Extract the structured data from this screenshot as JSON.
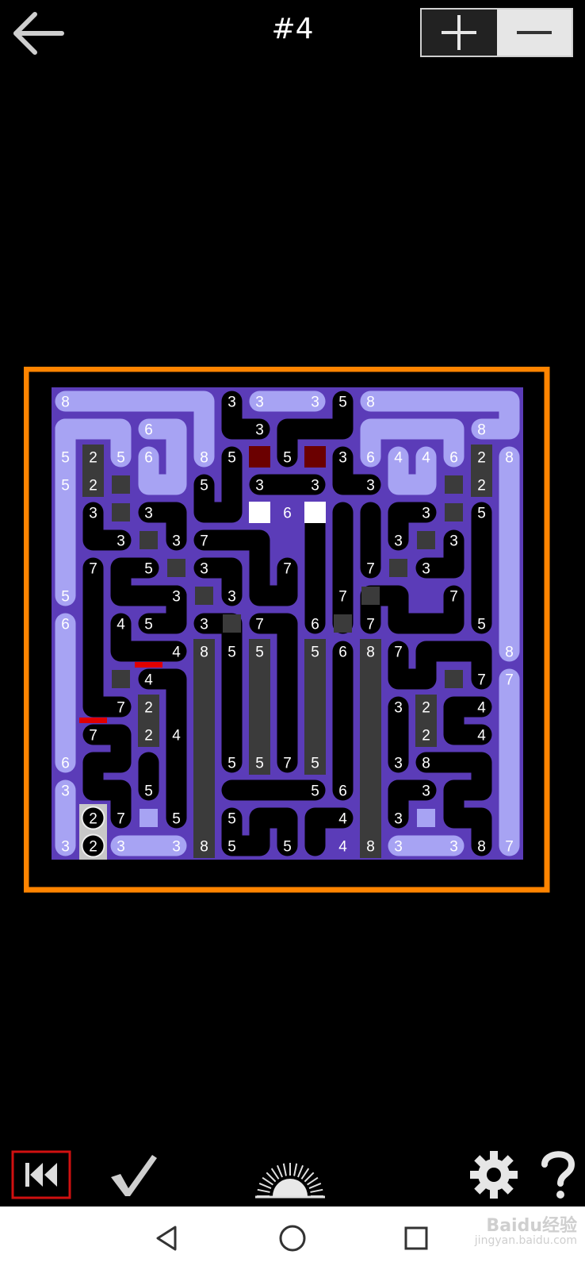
{
  "header": {
    "level_title": "#4",
    "back_icon": "back-arrow-icon",
    "zoom_in_icon": "plus-icon",
    "zoom_out_icon": "minus-icon"
  },
  "colors": {
    "frame": "#ff8400",
    "board_bg": "#5b3cb8",
    "pipe_light": "#a7a3f3",
    "pipe_dark": "#000000",
    "block": "#3b3b3b",
    "source_dark_red": "#6b0000",
    "target_white": "#ffffff",
    "mark_red": "#e00000"
  },
  "board": {
    "rows": 16,
    "cols": 17,
    "numbers": [
      {
        "r": 0,
        "c": 0,
        "v": "8"
      },
      {
        "r": 0,
        "c": 6,
        "v": "3"
      },
      {
        "r": 0,
        "c": 7,
        "v": "3"
      },
      {
        "r": 0,
        "c": 9,
        "v": "3"
      },
      {
        "r": 0,
        "c": 10,
        "v": "5"
      },
      {
        "r": 0,
        "c": 11,
        "v": "8"
      },
      {
        "r": 1,
        "c": 3,
        "v": "6"
      },
      {
        "r": 1,
        "c": 7,
        "v": "3"
      },
      {
        "r": 1,
        "c": 15,
        "v": "8"
      },
      {
        "r": 2,
        "c": 0,
        "v": "5"
      },
      {
        "r": 2,
        "c": 1,
        "v": "2"
      },
      {
        "r": 2,
        "c": 2,
        "v": "5"
      },
      {
        "r": 2,
        "c": 3,
        "v": "6"
      },
      {
        "r": 2,
        "c": 5,
        "v": "8"
      },
      {
        "r": 2,
        "c": 6,
        "v": "5"
      },
      {
        "r": 2,
        "c": 8,
        "v": "5"
      },
      {
        "r": 2,
        "c": 10,
        "v": "3"
      },
      {
        "r": 2,
        "c": 11,
        "v": "6"
      },
      {
        "r": 2,
        "c": 12,
        "v": "4"
      },
      {
        "r": 2,
        "c": 13,
        "v": "4"
      },
      {
        "r": 2,
        "c": 14,
        "v": "6"
      },
      {
        "r": 2,
        "c": 15,
        "v": "2"
      },
      {
        "r": 2,
        "c": 16,
        "v": "8"
      },
      {
        "r": 3,
        "c": 0,
        "v": "5"
      },
      {
        "r": 3,
        "c": 1,
        "v": "2"
      },
      {
        "r": 3,
        "c": 5,
        "v": "5"
      },
      {
        "r": 3,
        "c": 7,
        "v": "3"
      },
      {
        "r": 3,
        "c": 9,
        "v": "3"
      },
      {
        "r": 3,
        "c": 11,
        "v": "3"
      },
      {
        "r": 3,
        "c": 15,
        "v": "2"
      },
      {
        "r": 4,
        "c": 1,
        "v": "3"
      },
      {
        "r": 4,
        "c": 3,
        "v": "3"
      },
      {
        "r": 4,
        "c": 8,
        "v": "6"
      },
      {
        "r": 4,
        "c": 13,
        "v": "3"
      },
      {
        "r": 4,
        "c": 15,
        "v": "5"
      },
      {
        "r": 5,
        "c": 2,
        "v": "3"
      },
      {
        "r": 5,
        "c": 4,
        "v": "3"
      },
      {
        "r": 5,
        "c": 5,
        "v": "7"
      },
      {
        "r": 5,
        "c": 12,
        "v": "3"
      },
      {
        "r": 5,
        "c": 14,
        "v": "3"
      },
      {
        "r": 6,
        "c": 1,
        "v": "7"
      },
      {
        "r": 6,
        "c": 3,
        "v": "5"
      },
      {
        "r": 6,
        "c": 5,
        "v": "3"
      },
      {
        "r": 6,
        "c": 8,
        "v": "7"
      },
      {
        "r": 6,
        "c": 11,
        "v": "7"
      },
      {
        "r": 6,
        "c": 13,
        "v": "3"
      },
      {
        "r": 7,
        "c": 0,
        "v": "5"
      },
      {
        "r": 7,
        "c": 4,
        "v": "3"
      },
      {
        "r": 7,
        "c": 6,
        "v": "3"
      },
      {
        "r": 7,
        "c": 10,
        "v": "7"
      },
      {
        "r": 7,
        "c": 14,
        "v": "7"
      },
      {
        "r": 8,
        "c": 0,
        "v": "6"
      },
      {
        "r": 8,
        "c": 2,
        "v": "4"
      },
      {
        "r": 8,
        "c": 3,
        "v": "5"
      },
      {
        "r": 8,
        "c": 5,
        "v": "3"
      },
      {
        "r": 8,
        "c": 7,
        "v": "7"
      },
      {
        "r": 8,
        "c": 9,
        "v": "6"
      },
      {
        "r": 8,
        "c": 11,
        "v": "7"
      },
      {
        "r": 8,
        "c": 15,
        "v": "5"
      },
      {
        "r": 9,
        "c": 4,
        "v": "4"
      },
      {
        "r": 9,
        "c": 5,
        "v": "8"
      },
      {
        "r": 9,
        "c": 6,
        "v": "5"
      },
      {
        "r": 9,
        "c": 7,
        "v": "5"
      },
      {
        "r": 9,
        "c": 9,
        "v": "5"
      },
      {
        "r": 9,
        "c": 10,
        "v": "6"
      },
      {
        "r": 9,
        "c": 11,
        "v": "8"
      },
      {
        "r": 9,
        "c": 12,
        "v": "7"
      },
      {
        "r": 9,
        "c": 16,
        "v": "8"
      },
      {
        "r": 10,
        "c": 3,
        "v": "4"
      },
      {
        "r": 10,
        "c": 15,
        "v": "7"
      },
      {
        "r": 10,
        "c": 16,
        "v": "7"
      },
      {
        "r": 11,
        "c": 2,
        "v": "7"
      },
      {
        "r": 11,
        "c": 3,
        "v": "2"
      },
      {
        "r": 11,
        "c": 12,
        "v": "3"
      },
      {
        "r": 11,
        "c": 13,
        "v": "2"
      },
      {
        "r": 11,
        "c": 15,
        "v": "4"
      },
      {
        "r": 12,
        "c": 1,
        "v": "7"
      },
      {
        "r": 12,
        "c": 3,
        "v": "2"
      },
      {
        "r": 12,
        "c": 4,
        "v": "4"
      },
      {
        "r": 12,
        "c": 13,
        "v": "2"
      },
      {
        "r": 12,
        "c": 15,
        "v": "4"
      },
      {
        "r": 13,
        "c": 0,
        "v": "6"
      },
      {
        "r": 13,
        "c": 6,
        "v": "5"
      },
      {
        "r": 13,
        "c": 7,
        "v": "5"
      },
      {
        "r": 13,
        "c": 8,
        "v": "7"
      },
      {
        "r": 13,
        "c": 9,
        "v": "5"
      },
      {
        "r": 13,
        "c": 12,
        "v": "3"
      },
      {
        "r": 13,
        "c": 13,
        "v": "8"
      },
      {
        "r": 14,
        "c": 0,
        "v": "3"
      },
      {
        "r": 14,
        "c": 3,
        "v": "5"
      },
      {
        "r": 14,
        "c": 9,
        "v": "5"
      },
      {
        "r": 14,
        "c": 10,
        "v": "6"
      },
      {
        "r": 14,
        "c": 13,
        "v": "3"
      },
      {
        "r": 15,
        "c": 2,
        "v": "7"
      },
      {
        "r": 15,
        "c": 4,
        "v": "5"
      },
      {
        "r": 15,
        "c": 6,
        "v": "5"
      },
      {
        "r": 15,
        "c": 10,
        "v": "4"
      },
      {
        "r": 15,
        "c": 12,
        "v": "3"
      },
      {
        "r": 16,
        "c": 0,
        "v": "3"
      },
      {
        "r": 16,
        "c": 2,
        "v": "3"
      },
      {
        "r": 16,
        "c": 4,
        "v": "3"
      },
      {
        "r": 16,
        "c": 5,
        "v": "8"
      },
      {
        "r": 16,
        "c": 6,
        "v": "5"
      },
      {
        "r": 16,
        "c": 8,
        "v": "5"
      },
      {
        "r": 16,
        "c": 10,
        "v": "4"
      },
      {
        "r": 16,
        "c": 11,
        "v": "8"
      },
      {
        "r": 16,
        "c": 12,
        "v": "3"
      },
      {
        "r": 16,
        "c": 14,
        "v": "3"
      },
      {
        "r": 16,
        "c": 15,
        "v": "8"
      },
      {
        "r": 16,
        "c": 16,
        "v": "7"
      }
    ],
    "circle_tokens": [
      {
        "r": 15,
        "c": 1,
        "v": "2"
      },
      {
        "r": 16,
        "c": 1,
        "v": "2"
      }
    ]
  },
  "bottom": {
    "rewind_icon": "rewind-icon",
    "check_icon": "checkmark-icon",
    "sun_icon": "sunrise-icon",
    "settings_icon": "gear-icon",
    "help_icon": "question-icon"
  },
  "nav": {
    "back_icon": "nav-back-icon",
    "home_icon": "nav-home-icon",
    "recents_icon": "nav-recents-icon"
  },
  "watermark": {
    "logo": "Baidu经验",
    "url": "jingyan.baidu.com"
  }
}
